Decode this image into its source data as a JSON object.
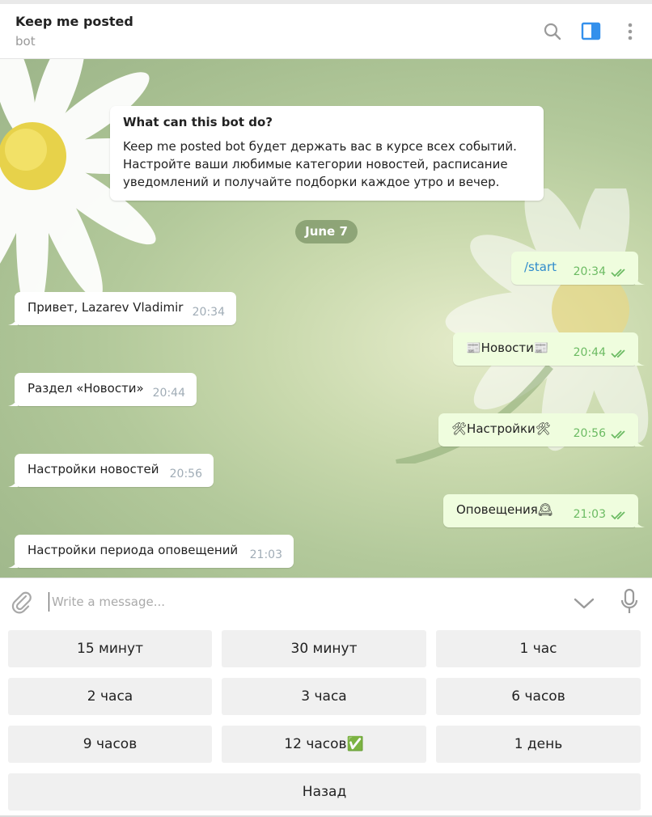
{
  "header": {
    "title": "Keep me posted",
    "subtitle": "bot",
    "icons": [
      "search-icon",
      "sidebar-toggle-icon",
      "more-vertical-icon"
    ],
    "accent": "#3390ec"
  },
  "info_card": {
    "title": "What can this bot do?",
    "lines": [
      "Keep me posted bot будет держать вас в курсе всех событий.",
      "Настройте ваши любимые категории новостей, расписание",
      "уведомлений и получайте подборки каждое утро и вечер."
    ]
  },
  "date_label": "June 7",
  "messages": [
    {
      "dir": "out",
      "text": "/start",
      "time": "20:34",
      "command": true
    },
    {
      "dir": "in",
      "text": "Привет, Lazarev Vladimir",
      "time": "20:34"
    },
    {
      "dir": "out",
      "text": "📰Новости📰",
      "time": "20:44"
    },
    {
      "dir": "in",
      "text": "Раздел «Новости»",
      "time": "20:44"
    },
    {
      "dir": "out",
      "text": "🛠Настройки🛠",
      "time": "20:56"
    },
    {
      "dir": "in",
      "text": "Настройки новостей",
      "time": "20:56"
    },
    {
      "dir": "out",
      "text": "Оповещения🕰",
      "time": "21:03"
    },
    {
      "dir": "in",
      "text": "Настройки периода оповещений",
      "time": "21:03"
    }
  ],
  "composer": {
    "placeholder": "Write a message...",
    "icons": [
      "paperclip-icon",
      "chevron-down-icon",
      "microphone-icon"
    ]
  },
  "keyboard": {
    "rows": [
      [
        "15 минут",
        "30 минут",
        "1 час"
      ],
      [
        "2 часа",
        "3 часа",
        "6 часов"
      ],
      [
        "9 часов",
        "12 часов✅",
        "1 день"
      ],
      [
        "Назад"
      ]
    ]
  },
  "colors": {
    "outgoing_bubble": "#effdde",
    "incoming_bubble": "#ffffff",
    "read_check": "#6cbb63",
    "command_link": "#2f8bcc"
  }
}
